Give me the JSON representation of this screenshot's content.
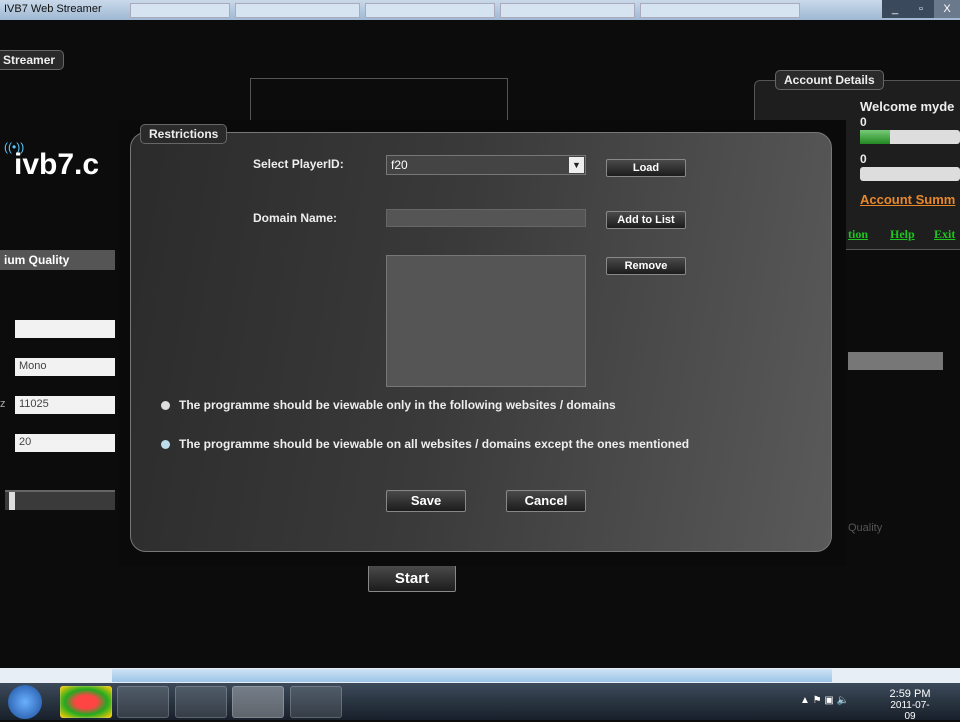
{
  "window": {
    "title": "IVB7 Web Streamer",
    "controls": [
      "_",
      "▫",
      "X"
    ]
  },
  "app": {
    "streamer_tab": "Streamer",
    "logo": "ivb7.c",
    "quality_label": "ium Quality",
    "fields": {
      "channels": "Mono",
      "sample_rate": "11025",
      "bitrate": "20",
      "sample_rate_prefix": "z"
    },
    "start_label": "Start",
    "quality_faint": "Quality",
    "account": {
      "tab": "Account Details",
      "welcome": "Welcome myde",
      "value1": "0",
      "value2": "0",
      "progress1": 0.3,
      "progress2": 0,
      "summary_link": "Account Summ",
      "links": [
        "tion",
        "Help",
        "Exit"
      ]
    }
  },
  "dialog": {
    "tab": "Restrictions",
    "player_label": "Select PlayerID:",
    "player_value": "f20",
    "load": "Load",
    "domain_label": "Domain Name:",
    "domain_value": "",
    "add": "Add to List",
    "remove": "Remove",
    "radio1": "The programme should be viewable only in the following websites / domains",
    "radio2": "The programme should be viewable on all websites / domains except the ones mentioned",
    "save": "Save",
    "cancel": "Cancel"
  },
  "taskbar": {
    "time": "2:59 PM",
    "date": "2011-07-09"
  }
}
